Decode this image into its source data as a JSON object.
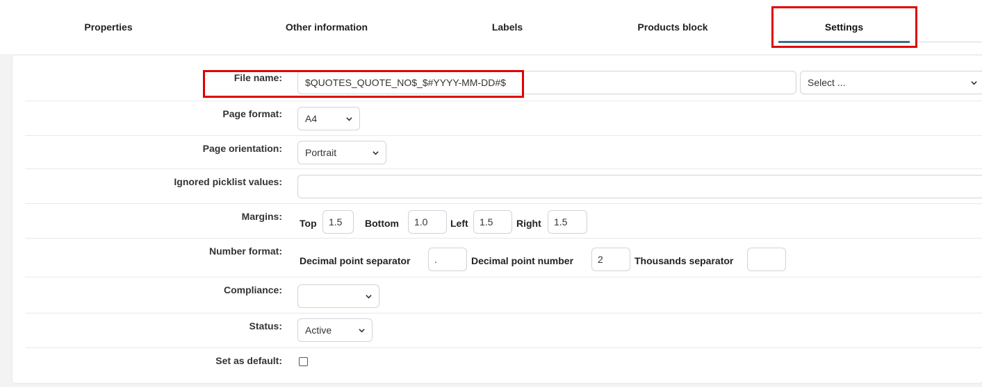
{
  "tabs": [
    {
      "label": "Properties"
    },
    {
      "label": "Other information"
    },
    {
      "label": "Labels"
    },
    {
      "label": "Products block"
    },
    {
      "label": "Settings",
      "active": true
    }
  ],
  "colors": {
    "highlight": "#e10000",
    "active_underline": "#3a6f86"
  },
  "form": {
    "file_name": {
      "label": "File name:",
      "value": "$QUOTES_QUOTE_NO$_$#YYYY-MM-DD#$",
      "variable_select": "Select ..."
    },
    "page_format": {
      "label": "Page format:",
      "value": "A4"
    },
    "page_orientation": {
      "label": "Page orientation:",
      "value": "Portrait"
    },
    "ignored_picklist": {
      "label": "Ignored picklist values:",
      "value": ""
    },
    "margins": {
      "label": "Margins:",
      "top_label": "Top",
      "top": "1.5",
      "bottom_label": "Bottom",
      "bottom": "1.0",
      "left_label": "Left",
      "left": "1.5",
      "right_label": "Right",
      "right": "1.5"
    },
    "number_format": {
      "label": "Number format:",
      "decimal_sep_label": "Decimal point separator",
      "decimal_sep": ".",
      "decimal_num_label": "Decimal point number",
      "decimal_num": "2",
      "thousands_label": "Thousands separator",
      "thousands": ""
    },
    "compliance": {
      "label": "Compliance:",
      "value": ""
    },
    "status": {
      "label": "Status:",
      "value": "Active"
    },
    "set_default": {
      "label": "Set as default:",
      "checked": false
    }
  }
}
